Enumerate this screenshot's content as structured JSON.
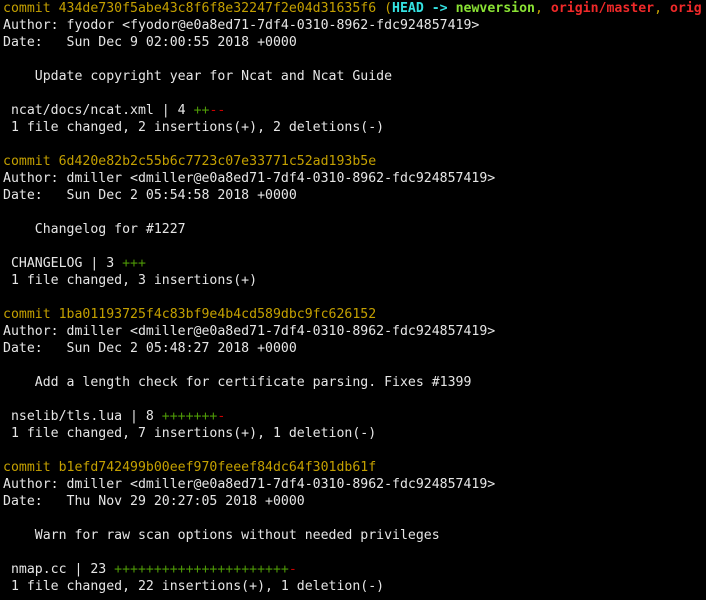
{
  "colors": {
    "background": "#000000",
    "text": "#e6e6e6",
    "commit_hash": "#c4a000",
    "head": "#34e2e2",
    "local_branch": "#8ae234",
    "remote_branch": "#ef2929",
    "additions": "#4e9a06",
    "deletions": "#cc0000"
  },
  "commits": [
    {
      "commit_prefix": "commit 434de730f5abe43c8f6f8e32247f2e04d31635f6 (",
      "head_label": "HEAD -> ",
      "branch_label": "newversion",
      "separator1": ", ",
      "remote_master": "origin/master",
      "separator2": ", ",
      "remote_trunc": "orig",
      "author": "Author: fyodor <fyodor@e0a8ed71-7df4-0310-8962-fdc924857419>",
      "date": "Date:   Sun Dec 9 02:00:55 2018 +0000",
      "message": "    Update copyright year for Ncat and Ncat Guide",
      "file_stat_name": " ncat/docs/ncat.xml | 4 ",
      "file_stat_plus": "++",
      "file_stat_minus": "--",
      "summary": " 1 file changed, 2 insertions(+), 2 deletions(-)"
    },
    {
      "commit_line": "commit 6d420e82b2c55b6c7723c07e33771c52ad193b5e",
      "author": "Author: dmiller <dmiller@e0a8ed71-7df4-0310-8962-fdc924857419>",
      "date": "Date:   Sun Dec 2 05:54:58 2018 +0000",
      "message": "    Changelog for #1227",
      "file_stat_name": " CHANGELOG | 3 ",
      "file_stat_plus": "+++",
      "file_stat_minus": "",
      "summary": " 1 file changed, 3 insertions(+)"
    },
    {
      "commit_line": "commit 1ba01193725f4c83bf9e4b4cd589dbc9fc626152",
      "author": "Author: dmiller <dmiller@e0a8ed71-7df4-0310-8962-fdc924857419>",
      "date": "Date:   Sun Dec 2 05:48:27 2018 +0000",
      "message": "    Add a length check for certificate parsing. Fixes #1399",
      "file_stat_name": " nselib/tls.lua | 8 ",
      "file_stat_plus": "+++++++",
      "file_stat_minus": "-",
      "summary": " 1 file changed, 7 insertions(+), 1 deletion(-)"
    },
    {
      "commit_line": "commit b1efd742499b00eef970feeef84dc64f301db61f",
      "author": "Author: dmiller <dmiller@e0a8ed71-7df4-0310-8962-fdc924857419>",
      "date": "Date:   Thu Nov 29 20:27:05 2018 +0000",
      "message": "    Warn for raw scan options without needed privileges",
      "file_stat_name": " nmap.cc | 23 ",
      "file_stat_plus": "++++++++++++++++++++++",
      "file_stat_minus": "-",
      "summary": " 1 file changed, 22 insertions(+), 1 deletion(-)"
    }
  ]
}
